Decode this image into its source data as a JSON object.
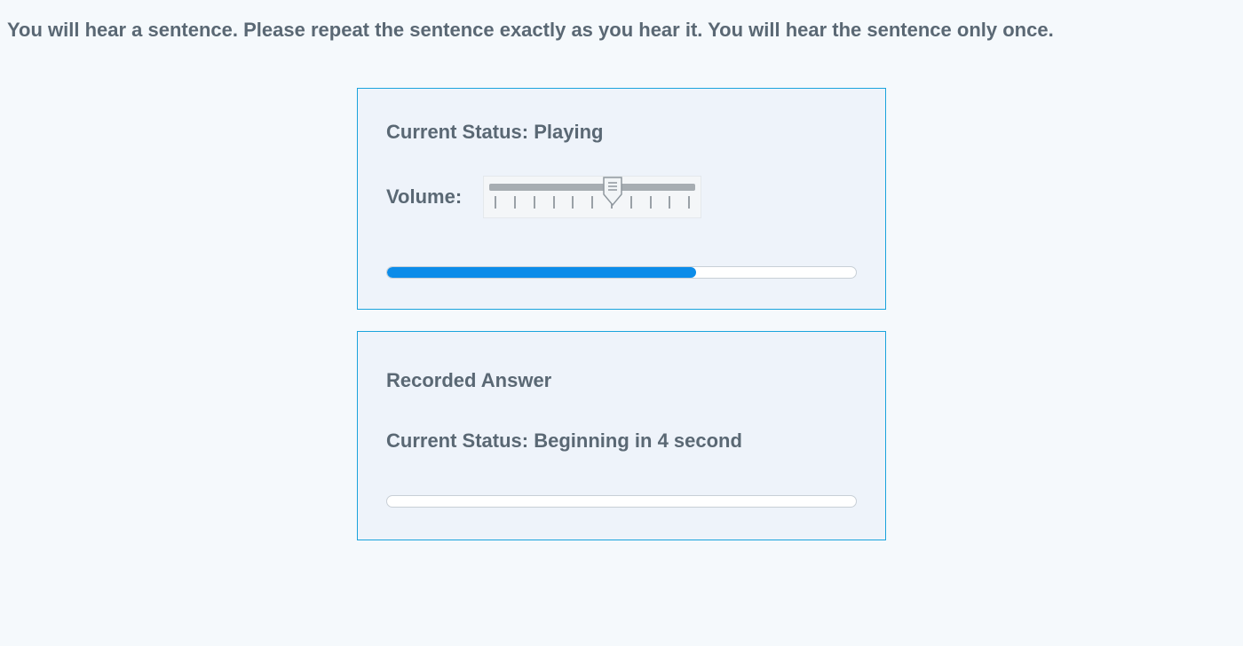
{
  "instructions": "You will hear a sentence. Please repeat the sentence exactly as you hear it. You will hear the sentence only once.",
  "playback": {
    "status_label": "Current Status: ",
    "status_value": "Playing",
    "volume_label": "Volume:",
    "volume_percent": 60,
    "progress_percent": 66,
    "tick_count": 11
  },
  "recording": {
    "title": "Recorded Answer",
    "status_label": "Current Status: ",
    "status_value": "Beginning in 4 second",
    "progress_percent": 0
  },
  "colors": {
    "accent": "#0c8ce9",
    "panel_border": "#1aa3dd",
    "panel_bg": "#eef3fa",
    "text": "#5a6874"
  }
}
